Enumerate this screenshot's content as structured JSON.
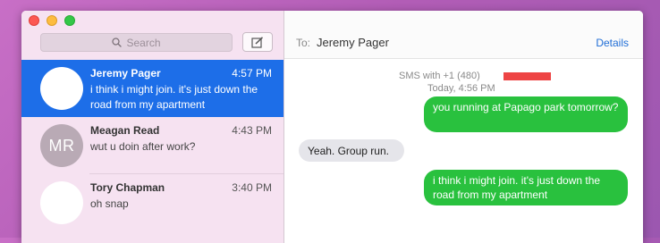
{
  "sidebar": {
    "search_placeholder": "Search",
    "conversations": [
      {
        "name": "Jeremy Pager",
        "time": "4:57 PM",
        "preview": "i think i might join. it's just down the road from my apartment",
        "initials": "",
        "selected": true
      },
      {
        "name": "Meagan Read",
        "time": "4:43 PM",
        "preview": "wut u doin after work?",
        "initials": "MR",
        "selected": false
      },
      {
        "name": "Tory Chapman",
        "time": "3:40 PM",
        "preview": "oh snap",
        "initials": "",
        "selected": false
      }
    ]
  },
  "header": {
    "to_label": "To:",
    "recipient": "Jeremy Pager",
    "details_label": "Details"
  },
  "chat": {
    "sms_info": "SMS with +1 (480)",
    "timestamp": "Today, 4:56 PM",
    "messages": [
      {
        "direction": "outgoing",
        "text": "you running at Papago park tomorrow?"
      },
      {
        "direction": "incoming",
        "text": "Yeah. Group run."
      },
      {
        "direction": "outgoing",
        "text": "i think i might join. it's just down the road from my apartment"
      }
    ]
  },
  "colors": {
    "selected_row": "#1d6ee8",
    "outgoing_bubble": "#29c13e",
    "incoming_bubble": "#e5e5ea",
    "details_link": "#1f6dd6",
    "redaction": "#ee4444"
  }
}
